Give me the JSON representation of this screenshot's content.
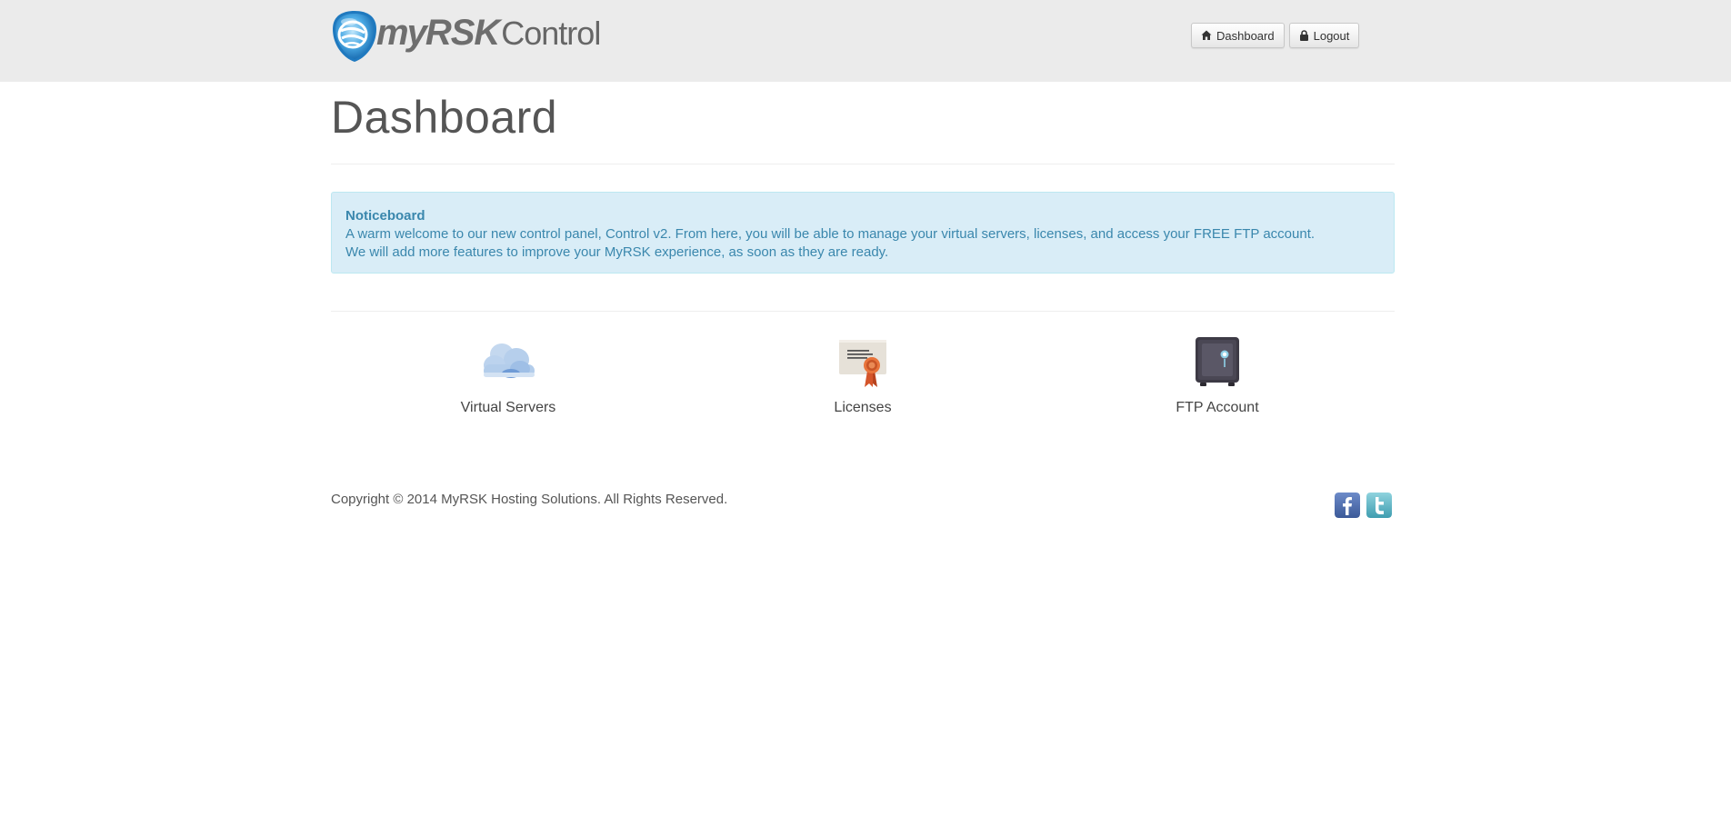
{
  "header": {
    "logo": {
      "my": "my",
      "rsk": "RSK",
      "control": "Control"
    },
    "nav": [
      {
        "label": "Dashboard",
        "icon": "home-icon"
      },
      {
        "label": "Logout",
        "icon": "lock-icon"
      }
    ]
  },
  "page": {
    "title": "Dashboard"
  },
  "noticeboard": {
    "title": "Noticeboard",
    "lines": [
      "A warm welcome to our new control panel, Control v2. From here, you will be able to manage your virtual servers, licenses, and access your FREE FTP account.",
      "We will add more features to improve your MyRSK experience, as soon as they are ready."
    ]
  },
  "features": [
    {
      "label": "Virtual Servers",
      "icon": "cloud-icon"
    },
    {
      "label": "Licenses",
      "icon": "certificate-icon"
    },
    {
      "label": "FTP Account",
      "icon": "safe-icon"
    }
  ],
  "footer": {
    "copyright": "Copyright © 2014 MyRSK Hosting Solutions. All Rights Reserved.",
    "social": [
      {
        "name": "Facebook",
        "icon": "facebook-icon",
        "color": "#3b5998"
      },
      {
        "name": "Twitter",
        "icon": "twitter-icon",
        "color": "#4aa8b8"
      }
    ]
  },
  "colors": {
    "header_bg": "#ebebeb",
    "notice_bg": "#d9edf7",
    "notice_text": "#3a87ad",
    "logo_blue": "#2f8fd0"
  }
}
